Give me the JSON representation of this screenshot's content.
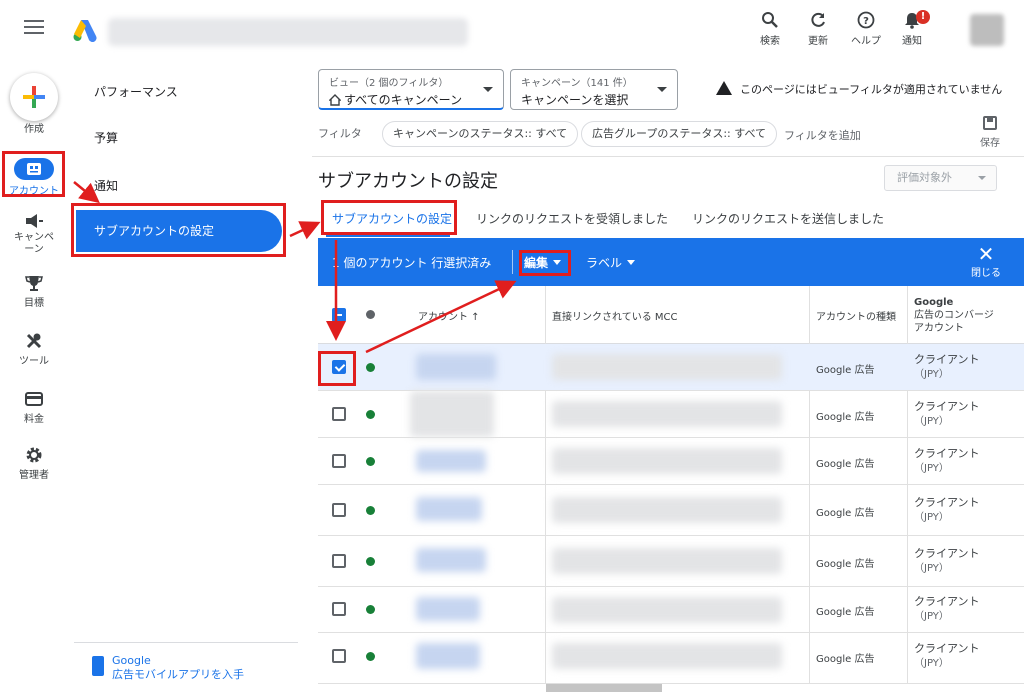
{
  "topbar": {
    "items": [
      {
        "label": "検索",
        "icon": "search-icon"
      },
      {
        "label": "更新",
        "icon": "refresh-icon"
      },
      {
        "label": "ヘルプ",
        "icon": "help-icon"
      },
      {
        "label": "通知",
        "icon": "bell-icon",
        "badge": "!"
      }
    ]
  },
  "leftnav": {
    "create_label": "作成",
    "items": [
      {
        "label": "アカウント",
        "icon": "account-icon",
        "active": true
      },
      {
        "label": "キャンペーン",
        "icon": "campaign-icon"
      },
      {
        "label": "目標",
        "icon": "trophy-icon"
      },
      {
        "label": "ツール",
        "icon": "tools-icon"
      },
      {
        "label": "料金",
        "icon": "billing-icon"
      },
      {
        "label": "管理者",
        "icon": "settings-icon"
      }
    ]
  },
  "subnav": {
    "items": [
      "パフォーマンス",
      "予算",
      "通知"
    ],
    "active": "サブアカウントの設定",
    "mobile_app": {
      "line1": "Google",
      "line2": "広告モバイルアプリを入手"
    }
  },
  "filters": {
    "view": {
      "small": "ビュー（2 個のフィルタ）",
      "main": "すべてのキャンペーン"
    },
    "campaign": {
      "small": "キャンペーン（141 件）",
      "main": "キャンペーンを選択"
    },
    "warning": "このページにはビューフィルタが適用されていません",
    "label": "フィルタ",
    "chips": [
      "キャンペーンのステータス:: すべて",
      "広告グループのステータス:: すべて"
    ],
    "add": "フィルタを追加",
    "save": "保存"
  },
  "page": {
    "title": "サブアカウントの設定",
    "eval_button": "評価対象外"
  },
  "tabs": [
    "サブアカウントの設定",
    "リンクのリクエストを受領しました",
    "リンクのリクエストを送信しました"
  ],
  "selection_bar": {
    "count": "1 個のアカウント 行選択済み",
    "edit": "編集",
    "label": "ラベル",
    "close": "閉じる"
  },
  "table": {
    "headers": {
      "account": "アカウント ↑",
      "mcc": "直接リンクされている MCC",
      "type": "アカウントの種類",
      "conv_line1": "Google",
      "conv_line2": "広告のコンバージ",
      "conv_line3": "アカウント"
    },
    "rows": [
      {
        "type": "Google 広告",
        "conv": "クライアント",
        "currency": "（JPY）",
        "checked": true
      },
      {
        "type": "Google 広告",
        "conv": "クライアント",
        "currency": "（JPY）",
        "checked": false
      },
      {
        "type": "Google 広告",
        "conv": "クライアント",
        "currency": "（JPY）",
        "checked": false
      },
      {
        "type": "Google 広告",
        "conv": "クライアント",
        "currency": "（JPY）",
        "checked": false
      },
      {
        "type": "Google 広告",
        "conv": "クライアント",
        "currency": "（JPY）",
        "checked": false
      },
      {
        "type": "Google 広告",
        "conv": "クライアント",
        "currency": "（JPY）",
        "checked": false
      },
      {
        "type": "Google 広告",
        "conv": "クライアント",
        "currency": "（JPY）",
        "checked": false
      }
    ]
  },
  "colors": {
    "accent": "#1a73e8",
    "annotation_red": "#e01e1e",
    "enabled_green": "#188038"
  }
}
